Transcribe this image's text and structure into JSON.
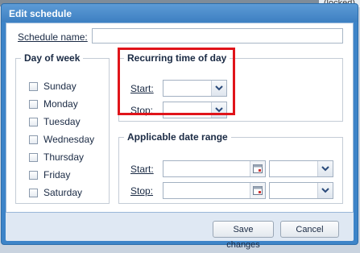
{
  "background": {
    "tag": "(locked)"
  },
  "dialog": {
    "title": "Edit schedule"
  },
  "schedule_name": {
    "label": "Schedule name:",
    "value": ""
  },
  "day_of_week": {
    "legend": "Day of week",
    "days": [
      "Sunday",
      "Monday",
      "Tuesday",
      "Wednesday",
      "Thursday",
      "Friday",
      "Saturday"
    ]
  },
  "recurring": {
    "legend": "Recurring time of day",
    "start_label": "Start:",
    "stop_label": "Stop:",
    "start_value": "",
    "stop_value": ""
  },
  "date_range": {
    "legend": "Applicable date range",
    "start_label": "Start:",
    "stop_label": "Stop:"
  },
  "buttons": {
    "save": "Save changes",
    "cancel": "Cancel"
  },
  "colors": {
    "highlight": "#e0141a",
    "titlebar": "#3e80c2"
  },
  "icons": {
    "dropdown": "chevron-down-icon",
    "calendar": "calendar-icon"
  }
}
